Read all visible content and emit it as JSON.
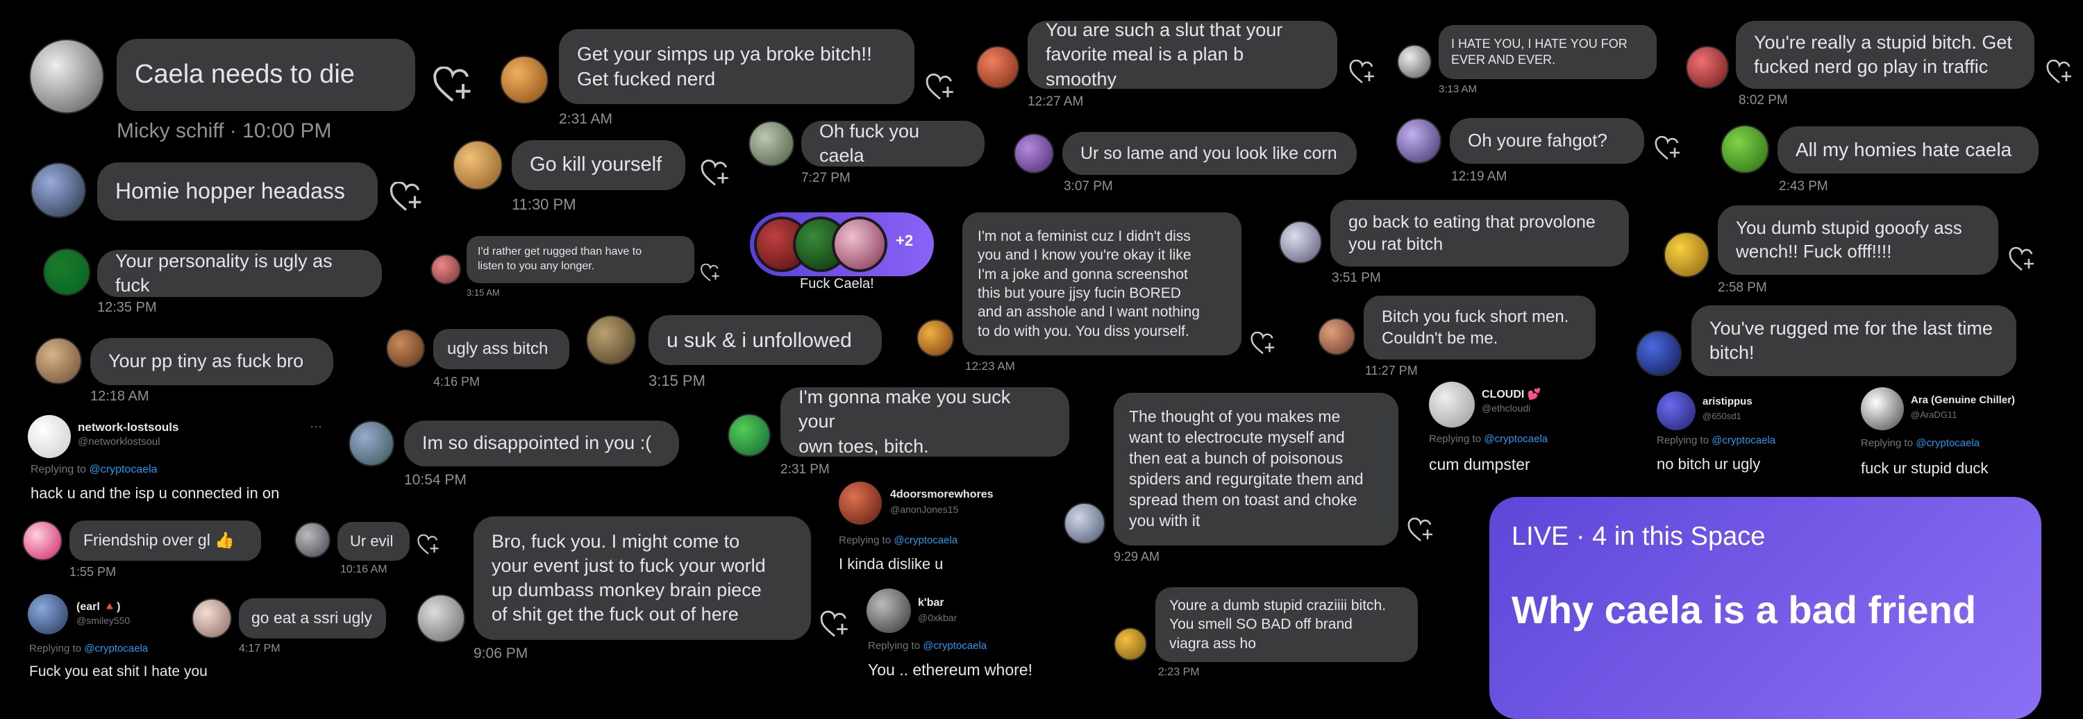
{
  "colors": {
    "background": "#000000",
    "bubble": "#3a3b3c",
    "timestamp": "#8e9297",
    "mention": "#1d9bf0",
    "space_purple": "#7b5cf0"
  },
  "icons": {
    "like": "heart-plus-icon"
  },
  "messages": [
    {
      "text": "Caela needs to die",
      "meta": "Micky schiff · 10:00 PM"
    },
    {
      "text": "Homie hopper headass",
      "time": ""
    },
    {
      "text": "Your personality is ugly as fuck",
      "time": "12:35 PM"
    },
    {
      "text": "Your pp tiny as fuck bro",
      "time": "12:18 AM"
    },
    {
      "text": "Get your simps up ya broke bitch!!\nGet fucked nerd",
      "time": "2:31 AM"
    },
    {
      "text": "Go kill yourself",
      "time": "11:30 PM"
    },
    {
      "text": "I'd rather get rugged than have to\nlisten to you any longer.",
      "time": "3:15 AM"
    },
    {
      "text": "ugly ass bitch",
      "time": "4:16 PM"
    },
    {
      "text": "u suk & i unfollowed",
      "time": "3:15 PM"
    },
    {
      "text": "Im so disappointed in you :(",
      "time": "10:54 PM"
    },
    {
      "text": "Friendship over gl 👍",
      "time": "1:55 PM"
    },
    {
      "text": "Ur evil",
      "time": "10:16 AM"
    },
    {
      "text": "go eat a ssri ugly",
      "time": "4:17 PM"
    },
    {
      "text": "Bro, fuck you. I might come to\nyour event just to fuck your world\nup dumbass monkey brain piece\nof shit get the fuck out of here",
      "time": "9:06 PM"
    },
    {
      "text": "Oh fuck you caela",
      "time": "7:27 PM"
    },
    {
      "text": "I'm gonna make you suck your\nown toes, bitch.",
      "time": "2:31 PM"
    },
    {
      "text": "I'm not a feminist cuz I didn't diss\nyou and I know you're okay it like\nI'm a joke and gonna screenshot\nthis but youre jjsy fucin BORED\nand an asshole and I want nothing\nto do with you. You diss yourself.",
      "time": "12:23 AM"
    },
    {
      "text": "You are such a slut that your\nfavorite meal is a plan b smoothy",
      "time": "12:27 AM"
    },
    {
      "text": "Ur so lame and you look like corn",
      "time": "3:07 PM"
    },
    {
      "text": "The thought of you makes me\nwant to electrocute myself and\nthen eat a bunch of poisonous\nspiders and regurgitate them and\nspread them on toast and choke\nyou with it",
      "time": "9:29 AM"
    },
    {
      "text": "Youre a dumb stupid craziiii bitch.\nYou smell SO BAD off brand\nviagra ass ho",
      "time": "2:23 PM"
    },
    {
      "text": "I HATE YOU, I HATE YOU FOR\nEVER AND EVER.",
      "time": "3:13 AM"
    },
    {
      "text": "Oh youre fahgot?",
      "time": "12:19 AM"
    },
    {
      "text": "go back to eating that provolone\nyou rat bitch",
      "time": "3:51 PM"
    },
    {
      "text": "Bitch you fuck short men.\nCouldn't be me.",
      "time": "11:27 PM"
    },
    {
      "text": "You're really a stupid bitch. Get\nfucked nerd go play in traffic",
      "time": "8:02 PM"
    },
    {
      "text": "All my homies hate caela",
      "time": "2:43 PM"
    },
    {
      "text": "You dumb stupid gooofy ass\nwench!! Fuck offf!!!!",
      "time": "2:58 PM"
    },
    {
      "text": "You've rugged me for the last time\nbitch!",
      "time": ""
    }
  ],
  "group_pill": {
    "count": "+2",
    "label": "Fuck Caela!"
  },
  "tweets": [
    {
      "name": "network-lostsouls",
      "handle": "@networklostsoul",
      "reply_prefix": "Replying to ",
      "mention": "@cryptocaela",
      "text": "hack u and the isp u connected in on",
      "more": "···"
    },
    {
      "name": "(earl 🔺)",
      "handle": "@smiley550",
      "reply_prefix": "Replying to ",
      "mention": "@cryptocaela",
      "text": "Fuck you eat shit I hate you"
    },
    {
      "name": "4doorsmorewhores",
      "handle": "@anonJones15",
      "reply_prefix": "Replying to ",
      "mention": "@cryptocaela",
      "text": "I kinda dislike u"
    },
    {
      "name": "k'bar",
      "handle": "@0xkbar",
      "reply_prefix": "Replying to ",
      "mention": "@cryptocaela",
      "text": "You .. ethereum whore!"
    },
    {
      "name": "CLOUDI 💕",
      "handle": "@ethcloudi",
      "reply_prefix": "Replying to ",
      "mention": "@cryptocaela",
      "text": "cum dumpster"
    },
    {
      "name": "aristippus",
      "handle": "@650sd1",
      "reply_prefix": "Replying to ",
      "mention": "@cryptocaela",
      "text": "no bitch ur ugly"
    },
    {
      "name": "Ara (Genuine Chiller)",
      "handle": "@AraDG11",
      "reply_prefix": "Replying to ",
      "mention": "@cryptocaela",
      "text": "fuck ur stupid duck"
    }
  ],
  "space": {
    "status": "LIVE · 4 in this Space",
    "title": "Why caela is a bad friend"
  }
}
